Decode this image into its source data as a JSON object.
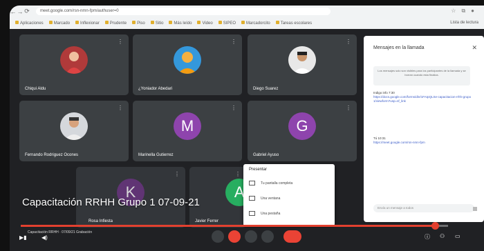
{
  "browser": {
    "url": "meet.google.com/rsn-nmn-fpm/authuser=0",
    "bookmarks": [
      "Aplicaciones",
      "Marcado",
      "Inflexionar",
      "Prudente",
      "Piso",
      "Sitio",
      "Más leído",
      "Video",
      "SIPEO",
      "Marcadorcito",
      "Tareas escolares",
      "Lista de lectura"
    ]
  },
  "participants": [
    {
      "name": "Chiqui Aldu",
      "avatar": "photo",
      "color": "#c0392b"
    },
    {
      "name": "¿Yoniador Abedari",
      "avatar": "photo",
      "color": "#f39c12"
    },
    {
      "name": "Diego Suarez",
      "avatar": "photo",
      "color": "#7f8c8d"
    },
    {
      "name": "Fernando Rodriguez Ocones",
      "avatar": "photo",
      "color": "#95a5a6"
    },
    {
      "name": "Marinella Gutierrez",
      "avatar": "M",
      "color": "#8e44ad"
    },
    {
      "name": "Gabriel Ayuso",
      "avatar": "G",
      "color": "#8e44ad"
    },
    {
      "name": "Rosa Infiesta",
      "avatar": "K",
      "color": "#6c3483"
    },
    {
      "name": "Javier Ferrer",
      "avatar": "A",
      "color": "#2ecc71"
    }
  ],
  "chat": {
    "title": "Mensajes en la llamada",
    "info": "Los mensajes solo son visibles para los participantes de la llamada y se borran cuando esta finaliza.",
    "messages": [
      {
        "who": "Indigo info  7:30",
        "text": "https://docs.google.com/forms/d/e/1FAIpQLSe-capacitacion-rrhh-grupo1/viewform?usp=sf_link"
      },
      {
        "who": "Tú  10:31",
        "text": "https://meet.google.com/rsn-nmn-fpm"
      }
    ],
    "input_placeholder": "Envía un mensaje a todos"
  },
  "present_menu": {
    "title": "Presentar",
    "items": [
      "Tu pantalla completa",
      "Una ventana",
      "Una pestaña"
    ]
  },
  "video": {
    "title": "Capacitación RRHH Grupo 1 07-09-21",
    "progress": 0.97,
    "meeting_label": "Capacitación RRHH · 07/09/21 Grabación"
  }
}
